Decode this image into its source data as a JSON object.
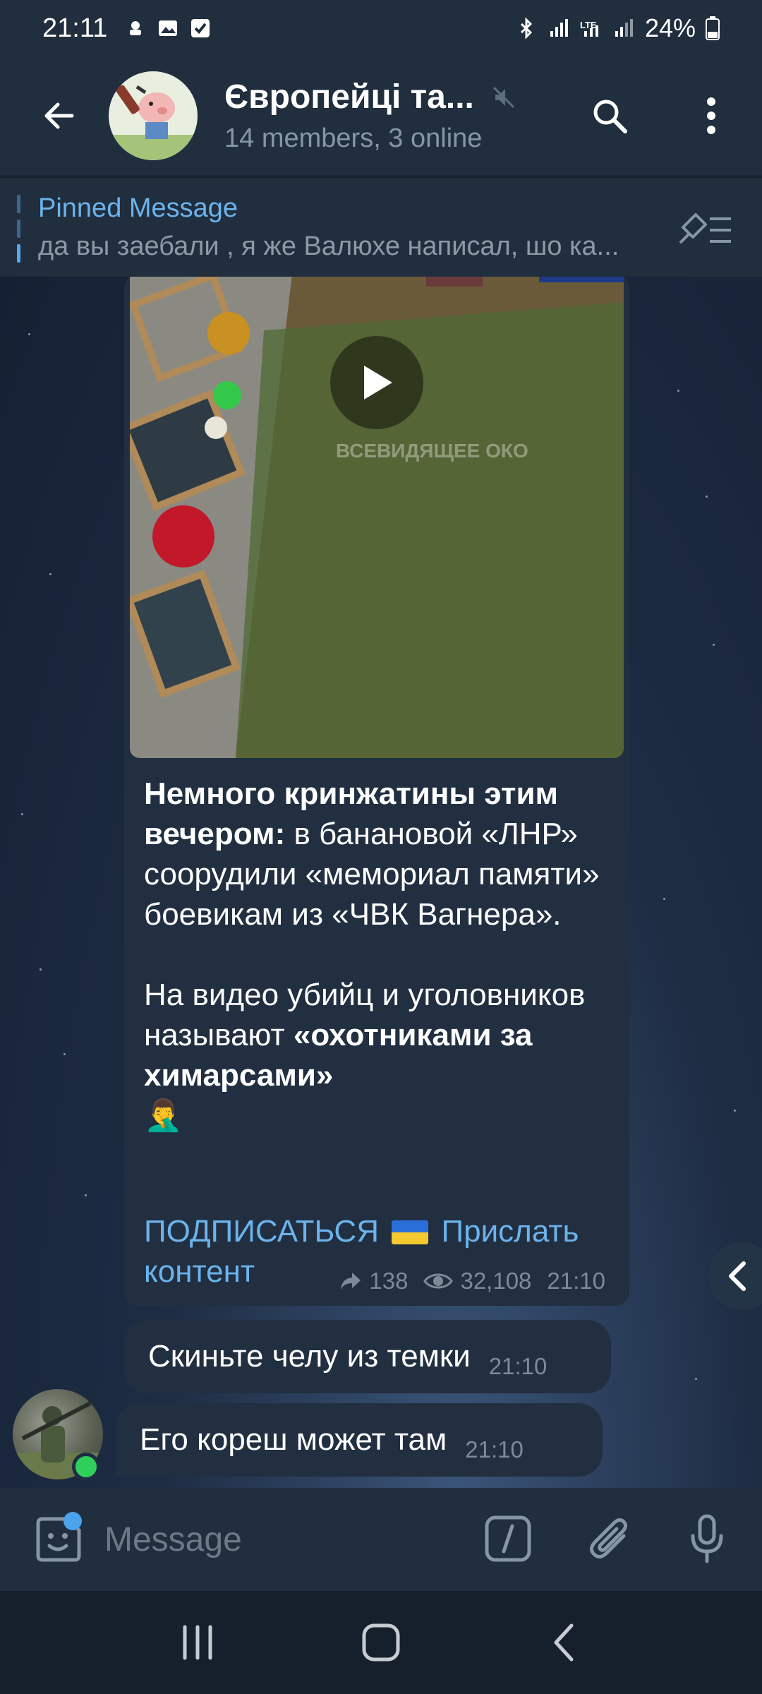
{
  "status_bar": {
    "time": "21:11",
    "battery": "24%",
    "icons": [
      "bluetooth-icon",
      "signal-icon",
      "lte-icon",
      "signal-icon",
      "battery-icon"
    ]
  },
  "header": {
    "title": "Європейці та...",
    "subtitle": "14 members, 3 online",
    "icons": [
      "back-arrow-icon",
      "muted-icon",
      "search-icon",
      "more-vertical-icon"
    ]
  },
  "pinned": {
    "label": "Pinned Message",
    "text": "да вы заебали , я же Валюхе написал, шо ка..."
  },
  "post": {
    "video_watermark": "ВСЕВИДЯЩЕЕ ОКО",
    "para1_bold": "Немного кринжатины этим вечером:",
    "para1_rest": " в банановой «ЛНР» соорудили «мемориал памяти» боевикам из «ЧВК Вагнера».",
    "para2_plain": "На видео убийц и уголовников называют ",
    "para2_bold": "«охотниками за химарсами»",
    "para2_emoji": "🤦‍♂️",
    "link1": "ПОДПИСАТЬСЯ",
    "link2": "Прислать контент",
    "forwards": "138",
    "views": "32,108",
    "time": "21:10"
  },
  "messages": [
    {
      "text": "Скиньте челу из темки",
      "time": "21:10"
    },
    {
      "text": "Его кореш  может там",
      "time": "21:10"
    }
  ],
  "input": {
    "placeholder": "Message"
  },
  "colors": {
    "accent": "#6cb3ec",
    "bubble": "#212f41",
    "bar": "#202e3e",
    "online": "#2fd05a"
  }
}
